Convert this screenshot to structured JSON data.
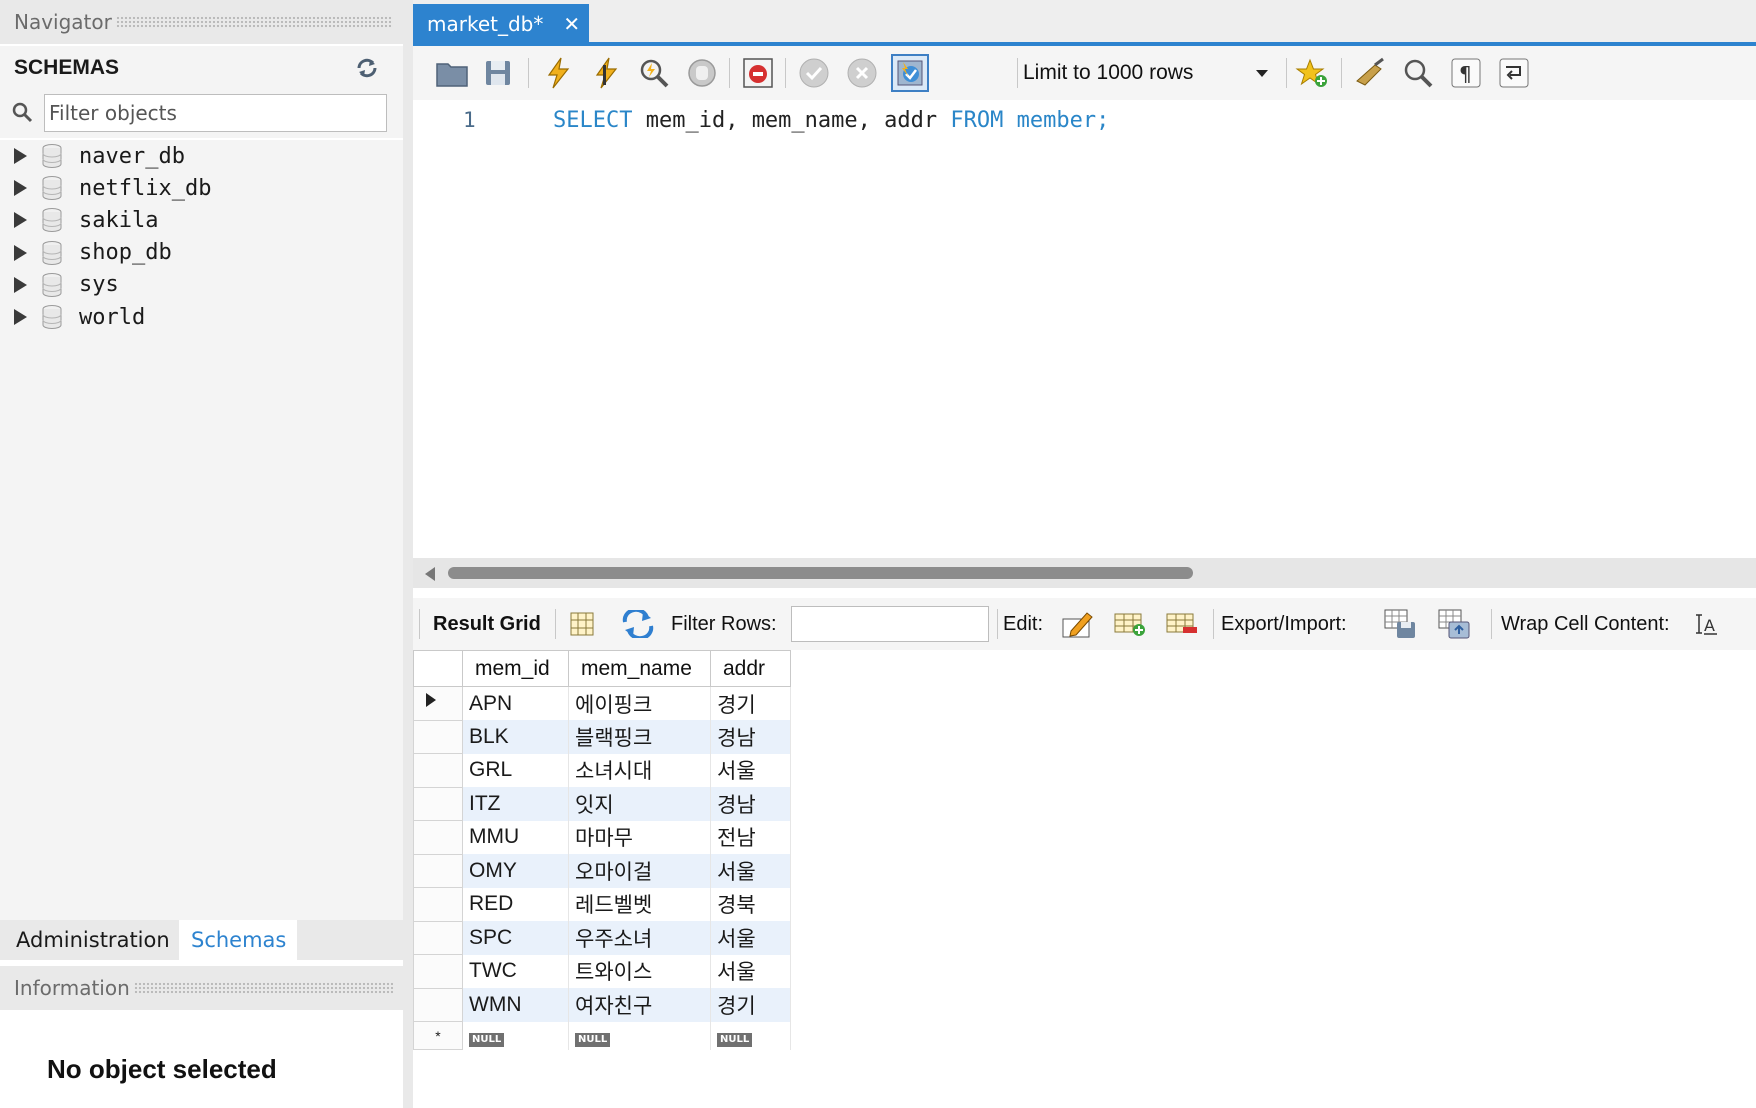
{
  "navigator": {
    "title": "Navigator",
    "schemas_label": "SCHEMAS",
    "filter_placeholder": "Filter objects",
    "schemas": [
      "naver_db",
      "netflix_db",
      "sakila",
      "shop_db",
      "sys",
      "world"
    ],
    "tabs": {
      "administration": "Administration",
      "schemas": "Schemas"
    },
    "information_title": "Information",
    "no_object": "No object selected"
  },
  "editor": {
    "tab_title": "market_db*",
    "tab_close": "✕",
    "limit_label": "Limit to 1000 rows",
    "line_number": "1",
    "sql": {
      "kw_select": "SELECT",
      "columns": " mem_id, mem_name, addr ",
      "kw_from": "FROM",
      "table": " member;"
    }
  },
  "result_toolbar": {
    "result_grid": "Result Grid",
    "filter_rows": "Filter Rows:",
    "edit": "Edit:",
    "export_import": "Export/Import:",
    "wrap_cell": "Wrap Cell Content:"
  },
  "grid": {
    "columns": [
      "mem_id",
      "mem_name",
      "addr"
    ],
    "rows": [
      [
        "APN",
        "에이핑크",
        "경기"
      ],
      [
        "BLK",
        "블랙핑크",
        "경남"
      ],
      [
        "GRL",
        "소녀시대",
        "서울"
      ],
      [
        "ITZ",
        "잇지",
        "경남"
      ],
      [
        "MMU",
        "마마무",
        "전남"
      ],
      [
        "OMY",
        "오마이걸",
        "서울"
      ],
      [
        "RED",
        "레드벨벳",
        "경북"
      ],
      [
        "SPC",
        "우주소녀",
        "서울"
      ],
      [
        "TWC",
        "트와이스",
        "서울"
      ],
      [
        "WMN",
        "여자친구",
        "경기"
      ]
    ],
    "null_label": "NULL",
    "new_row_marker": "*"
  },
  "colors": {
    "accent": "#2d83cf",
    "keyword": "#2a86c8",
    "alt_row": "#e9f1fb"
  }
}
